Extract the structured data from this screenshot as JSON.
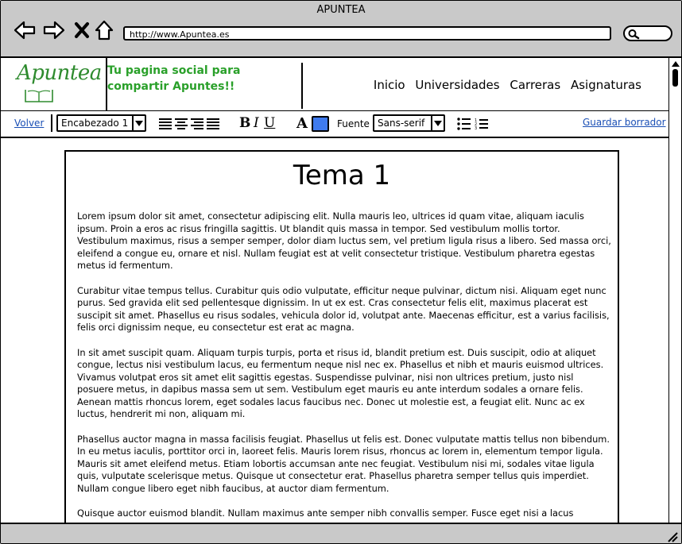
{
  "window": {
    "title": "APUNTEA"
  },
  "address_bar": {
    "url": "http://www.Apuntea.es"
  },
  "site": {
    "logo_text": "Apuntea",
    "tagline": "Tu pagina social para compartir Apuntes!!"
  },
  "nav": {
    "items": [
      {
        "label": "Inicio"
      },
      {
        "label": "Universidades"
      },
      {
        "label": "Carreras"
      },
      {
        "label": "Asignaturas"
      }
    ]
  },
  "toolbar": {
    "back_label": "Volver",
    "heading_select": "Encabezado 1",
    "bold": "B",
    "italic": "I",
    "underline": "U",
    "font_color_glyph": "A",
    "font_color": "#3f7bef",
    "font_label": "Fuente",
    "font_select": "Sans-serif",
    "save_draft_label": "Guardar borrador"
  },
  "document": {
    "title": "Tema 1",
    "paragraphs": [
      "Lorem ipsum dolor sit amet, consectetur adipiscing elit. Nulla mauris leo, ultrices id quam vitae, aliquam iaculis ipsum. Proin a eros ac risus fringilla sagittis. Ut blandit quis massa in tempor. Sed vestibulum mollis tortor. Vestibulum maximus, risus a semper semper, dolor diam luctus sem, vel pretium ligula risus a libero. Sed massa orci, eleifend a congue eu, ornare et nisl. Nullam feugiat est at velit consectetur tristique. Vestibulum pharetra egestas metus id fermentum.",
      "Curabitur vitae tempus tellus. Curabitur quis odio vulputate, efficitur neque pulvinar, dictum nisi. Aliquam eget nunc purus. Sed gravida elit sed pellentesque dignissim. In ut ex est. Cras consectetur felis elit, maximus placerat est suscipit sit amet. Phasellus eu risus sodales, vehicula dolor id, volutpat ante. Maecenas efficitur, est a varius facilisis, felis orci dignissim neque, eu consectetur est erat ac magna.",
      "In sit amet suscipit quam. Aliquam turpis turpis, porta et risus id, blandit pretium est. Duis suscipit, odio at aliquet congue, lectus nisi vestibulum lacus, eu fermentum neque nisl nec ex. Phasellus et nibh et mauris euismod ultrices. Vivamus volutpat eros sit amet elit sagittis egestas. Suspendisse pulvinar, nisi non ultrices pretium, justo nisl posuere metus, in dapibus massa sem ut sem. Vestibulum eget mauris eu ante interdum sodales a ornare felis. Aenean mattis rhoncus lorem, eget sodales lacus faucibus nec. Donec ut molestie est, a feugiat elit. Nunc ac ex luctus, hendrerit mi non, aliquam mi.",
      "Phasellus auctor magna in massa facilisis feugiat. Phasellus ut felis est. Donec vulputate mattis tellus non bibendum. In eu metus iaculis, porttitor orci in, laoreet felis. Mauris lorem risus, rhoncus ac lorem in, elementum tempor ligula. Mauris sit amet eleifend metus. Etiam lobortis accumsan ante nec feugiat. Vestibulum nisi mi, sodales vitae ligula quis, vulputate scelerisque metus. Quisque ut consectetur erat. Phasellus pharetra semper tellus quis imperdiet. Nullam congue libero eget nibh faucibus, at auctor diam fermentum.",
      "Quisque auctor euismod blandit. Nullam maximus ante semper nibh convallis semper. Fusce eget nisi a lacus"
    ]
  },
  "icons": {
    "back": "arrow-left-icon",
    "forward": "arrow-right-icon",
    "stop": "close-icon",
    "home": "home-icon",
    "search": "search-icon",
    "align": [
      "align-left-icon",
      "align-center-icon",
      "align-right-icon",
      "align-justify-icon"
    ],
    "lists": [
      "bullet-list-icon",
      "numbered-list-icon"
    ]
  }
}
